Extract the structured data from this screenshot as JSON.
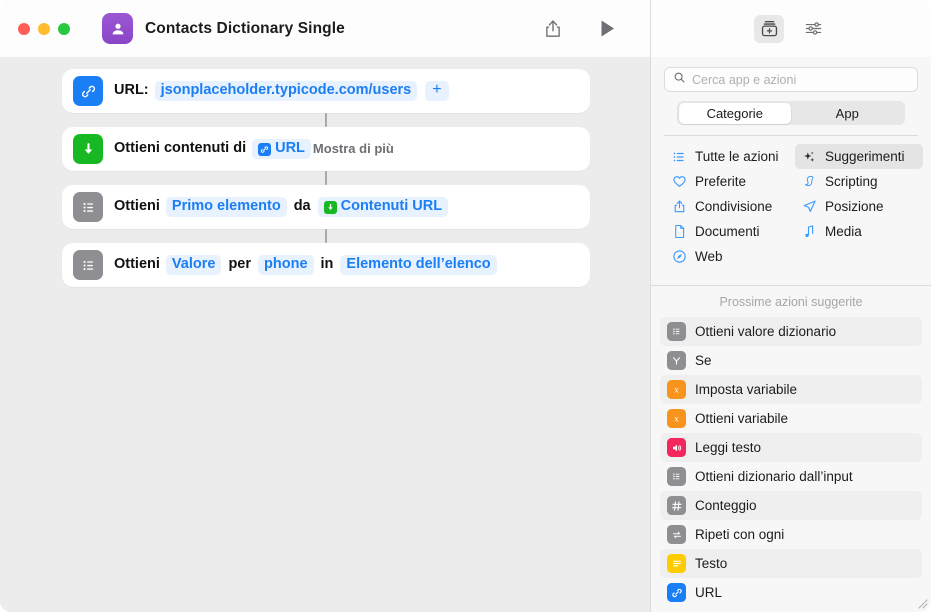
{
  "window": {
    "title": "Contacts Dictionary Single",
    "app_icon": "contacts-icon",
    "traffic_lights": [
      "close",
      "minimize",
      "zoom"
    ],
    "share_label": "share-icon",
    "run_label": "play-icon"
  },
  "workflow": {
    "actions": [
      {
        "icon": "url-link-icon",
        "icon_color": "#1a7ef4",
        "label": "URL:",
        "value": "jsonplaceholder.typicode.com/users",
        "add_label": "+"
      },
      {
        "icon": "download-arrow-icon",
        "icon_color": "#17b822",
        "label": "Ottieni contenuti di",
        "token": "URL",
        "token_icon": "url-link-icon",
        "show_more": "Mostra di più"
      },
      {
        "icon": "list-icon",
        "icon_color": "#8e8e93",
        "label": "Ottieni",
        "token1": "Primo elemento",
        "mid": "da",
        "token2": "Contenuti URL",
        "token2_icon": "download-arrow-icon"
      },
      {
        "icon": "list-icon",
        "icon_color": "#8e8e93",
        "label": "Ottieni",
        "token1": "Valore",
        "mid1": "per",
        "token2": "phone",
        "mid2": "in",
        "token3": "Elemento dell’elenco"
      }
    ]
  },
  "sidebar": {
    "top_buttons": [
      {
        "name": "action-library-icon",
        "selected": true
      },
      {
        "name": "sliders-icon",
        "selected": false
      }
    ],
    "search": {
      "placeholder": "Cerca app e azioni",
      "value": "",
      "icon": "search-icon"
    },
    "segments": [
      {
        "label": "Categorie",
        "selected": true
      },
      {
        "label": "App",
        "selected": false
      }
    ],
    "categories": [
      {
        "label": "Tutte le azioni",
        "icon": "list-bullet-icon",
        "selected": false
      },
      {
        "label": "Suggerimenti",
        "icon": "sparkles-icon",
        "selected": true
      },
      {
        "label": "Preferite",
        "icon": "heart-icon",
        "selected": false
      },
      {
        "label": "Scripting",
        "icon": "scripting-icon",
        "selected": false
      },
      {
        "label": "Condivisione",
        "icon": "share-icon",
        "selected": false
      },
      {
        "label": "Posizione",
        "icon": "location-arrow-icon",
        "selected": false
      },
      {
        "label": "Documenti",
        "icon": "document-icon",
        "selected": false
      },
      {
        "label": "Media",
        "icon": "music-note-icon",
        "selected": false
      },
      {
        "label": "Web",
        "icon": "safari-compass-icon",
        "selected": false
      }
    ],
    "suggestions_title": "Prossime azioni suggerite",
    "suggestions": [
      {
        "label": "Ottieni valore dizionario",
        "icon": "list-icon",
        "color": "si-gray",
        "alt": true
      },
      {
        "label": "Se",
        "icon": "branch-icon",
        "color": "si-gray",
        "alt": false
      },
      {
        "label": "Imposta variabile",
        "icon": "variable-icon",
        "color": "si-orange",
        "alt": true
      },
      {
        "label": "Ottieni variabile",
        "icon": "variable-icon",
        "color": "si-orange",
        "alt": false
      },
      {
        "label": "Leggi testo",
        "icon": "speaker-icon",
        "color": "si-pink",
        "alt": true
      },
      {
        "label": "Ottieni dizionario dall’input",
        "icon": "list-icon",
        "color": "si-gray",
        "alt": false
      },
      {
        "label": "Conteggio",
        "icon": "hash-icon",
        "color": "si-gray",
        "alt": true
      },
      {
        "label": "Ripeti con ogni",
        "icon": "repeat-icon",
        "color": "si-gray",
        "alt": false
      },
      {
        "label": "Testo",
        "icon": "text-lines-icon",
        "color": "si-yellow",
        "alt": true
      },
      {
        "label": "URL",
        "icon": "url-link-icon",
        "color": "si-blue",
        "alt": false
      }
    ]
  },
  "colors": {
    "accent_blue": "#1a7ef4",
    "green": "#17b822",
    "gray": "#8e8e93",
    "orange": "#f7941e",
    "pink": "#f4265e",
    "yellow": "#ffcc00",
    "purple": "#9b57d3",
    "canvas": "#ececec"
  }
}
